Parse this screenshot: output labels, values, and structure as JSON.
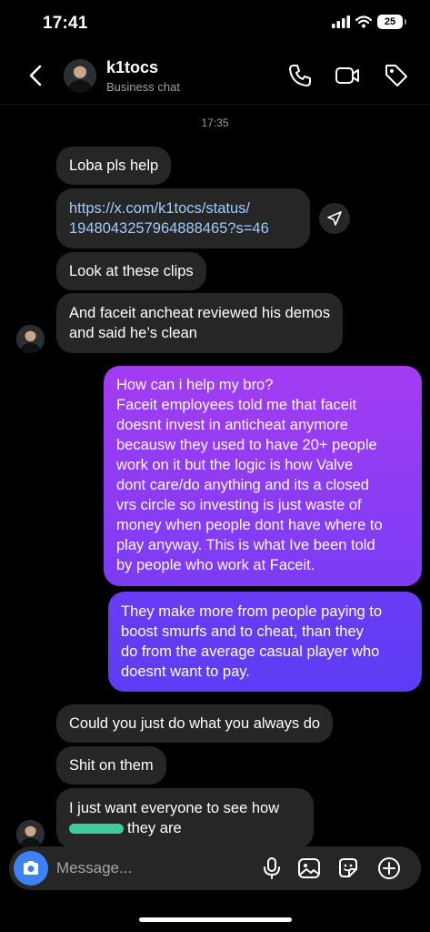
{
  "status": {
    "time": "17:41",
    "battery": "25"
  },
  "header": {
    "name": "k1tocs",
    "subtitle": "Business chat"
  },
  "thread": {
    "timestamp": "17:35",
    "incoming_1": [
      "Loba pls help",
      "https://x.com/k1tocs/status/",
      "1948043257964888465?s=46",
      "Look at these clips",
      "And faceit ancheat reviewed his demos",
      "and said he’s clean"
    ],
    "outgoing": [
      [
        "How can i help my bro?",
        "Faceit employees told me that faceit",
        "doesnt invest in anticheat anymore",
        "becausw they used to have 20+ people",
        "work on it but the logic is how Valve",
        "dont care/do anything and its a closed",
        "vrs circle so investing is just waste of",
        "money when people dont have where to",
        "play anyway. This is what Ive been told",
        "by people who work at Faceit."
      ],
      [
        "They make more from people paying to",
        "boost smurfs and to cheat, than they",
        "do from the average casual player who",
        "doesnt want to pay."
      ]
    ],
    "incoming_2": [
      "Could you just do what you always do",
      "Shit on them",
      "I just want everyone to see how",
      "they are"
    ]
  },
  "composer": {
    "placeholder": "Message..."
  },
  "colors": {
    "incoming_bubble": "#262626",
    "outgoing_gradient_top": "#a33cf2",
    "outgoing_gradient_bottom": "#5b3df5",
    "link": "#9fcbff",
    "camera_button": "#3b82f6"
  }
}
